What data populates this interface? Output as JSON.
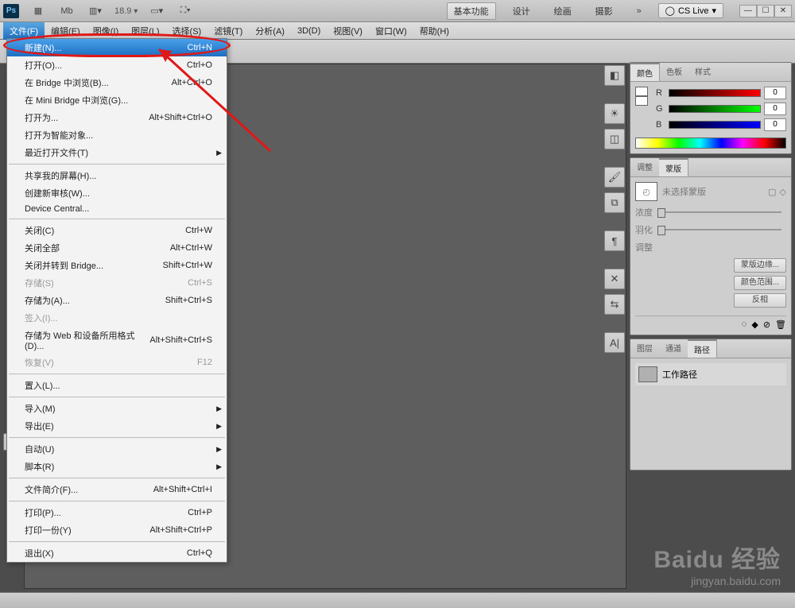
{
  "titlebar": {
    "zoom": "18.9",
    "workspaces": [
      "基本功能",
      "设计",
      "绘画",
      "摄影"
    ],
    "cslive": "CS Live"
  },
  "menubar": {
    "items": [
      "文件(F)",
      "编辑(E)",
      "图像(I)",
      "图层(L)",
      "选择(S)",
      "滤镜(T)",
      "分析(A)",
      "3D(D)",
      "视图(V)",
      "窗口(W)",
      "帮助(H)"
    ]
  },
  "file_menu": {
    "items": [
      {
        "label": "新建(N)...",
        "shortcut": "Ctrl+N",
        "highlight": true
      },
      {
        "label": "打开(O)...",
        "shortcut": "Ctrl+O"
      },
      {
        "label": "在 Bridge 中浏览(B)...",
        "shortcut": "Alt+Ctrl+O"
      },
      {
        "label": "在 Mini Bridge 中浏览(G)..."
      },
      {
        "label": "打开为...",
        "shortcut": "Alt+Shift+Ctrl+O"
      },
      {
        "label": "打开为智能对象..."
      },
      {
        "label": "最近打开文件(T)",
        "submenu": true
      },
      {
        "sep": true
      },
      {
        "label": "共享我的屏幕(H)..."
      },
      {
        "label": "创建新审核(W)..."
      },
      {
        "label": "Device Central..."
      },
      {
        "sep": true
      },
      {
        "label": "关闭(C)",
        "shortcut": "Ctrl+W"
      },
      {
        "label": "关闭全部",
        "shortcut": "Alt+Ctrl+W"
      },
      {
        "label": "关闭并转到 Bridge...",
        "shortcut": "Shift+Ctrl+W"
      },
      {
        "label": "存储(S)",
        "shortcut": "Ctrl+S",
        "disabled": true
      },
      {
        "label": "存储为(A)...",
        "shortcut": "Shift+Ctrl+S"
      },
      {
        "label": "签入(I)...",
        "disabled": true
      },
      {
        "label": "存储为 Web 和设备所用格式(D)...",
        "shortcut": "Alt+Shift+Ctrl+S"
      },
      {
        "label": "恢复(V)",
        "shortcut": "F12",
        "disabled": true
      },
      {
        "sep": true
      },
      {
        "label": "置入(L)..."
      },
      {
        "sep": true
      },
      {
        "label": "导入(M)",
        "submenu": true
      },
      {
        "label": "导出(E)",
        "submenu": true
      },
      {
        "sep": true
      },
      {
        "label": "自动(U)",
        "submenu": true
      },
      {
        "label": "脚本(R)",
        "submenu": true
      },
      {
        "sep": true
      },
      {
        "label": "文件简介(F)...",
        "shortcut": "Alt+Shift+Ctrl+I"
      },
      {
        "sep": true
      },
      {
        "label": "打印(P)...",
        "shortcut": "Ctrl+P"
      },
      {
        "label": "打印一份(Y)",
        "shortcut": "Alt+Shift+Ctrl+P"
      },
      {
        "sep": true
      },
      {
        "label": "退出(X)",
        "shortcut": "Ctrl+Q"
      }
    ]
  },
  "color_panel": {
    "tabs": [
      "颜色",
      "色板",
      "样式"
    ],
    "channels": [
      {
        "name": "R",
        "val": "0",
        "grad": "linear-gradient(90deg,#000,#f00)"
      },
      {
        "name": "G",
        "val": "0",
        "grad": "linear-gradient(90deg,#000,#0f0)"
      },
      {
        "name": "B",
        "val": "0",
        "grad": "linear-gradient(90deg,#000,#00f)"
      }
    ]
  },
  "masks_panel": {
    "tabs": [
      "调整",
      "蒙版"
    ],
    "title": "未选择蒙版",
    "rows": [
      "浓度",
      "羽化",
      "调整"
    ],
    "buttons": [
      "蒙版边缘...",
      "颜色范围...",
      "反相"
    ]
  },
  "paths_panel": {
    "tabs": [
      "图层",
      "通道",
      "路径"
    ],
    "item": "工作路径"
  },
  "watermark": {
    "brand": "Baidu 经验",
    "url": "jingyan.baidu.com"
  }
}
